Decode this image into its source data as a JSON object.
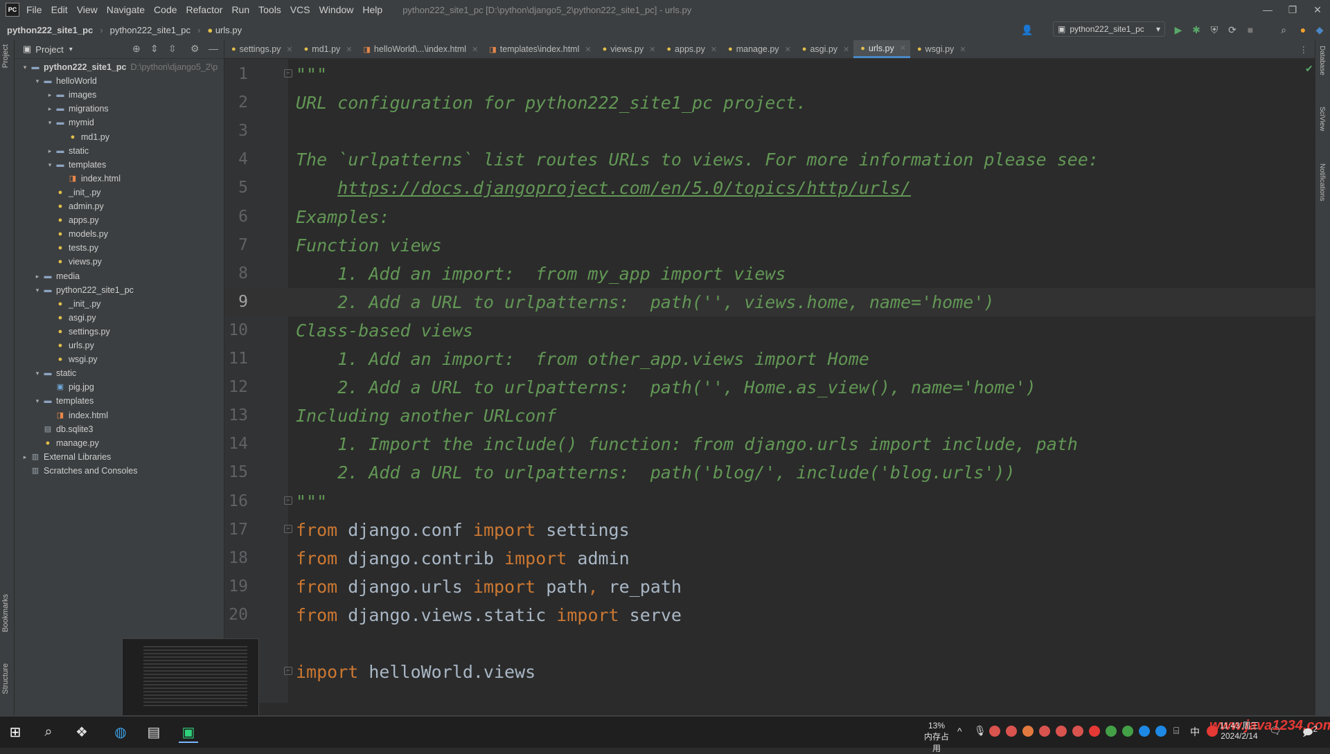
{
  "menubar": {
    "logo": "PC",
    "items": [
      "File",
      "Edit",
      "View",
      "Navigate",
      "Code",
      "Refactor",
      "Run",
      "Tools",
      "VCS",
      "Window",
      "Help"
    ],
    "window_title": "python222_site1_pc [D:\\python\\django5_2\\python222_site1_pc] - urls.py"
  },
  "navbar": {
    "breadcrumbs": [
      "python222_site1_pc",
      "python222_site1_pc",
      "urls.py"
    ],
    "run_config": "python222_site1_pc"
  },
  "project_panel": {
    "title": "Project",
    "tree": [
      {
        "depth": 0,
        "arrow": "▾",
        "icon": "folder",
        "label": "python222_site1_pc",
        "hint": "D:\\python\\django5_2\\p",
        "bold": true
      },
      {
        "depth": 1,
        "arrow": "▾",
        "icon": "folder",
        "label": "helloWorld"
      },
      {
        "depth": 2,
        "arrow": "▸",
        "icon": "folder",
        "label": "images"
      },
      {
        "depth": 2,
        "arrow": "▸",
        "icon": "folder",
        "label": "migrations"
      },
      {
        "depth": 2,
        "arrow": "▾",
        "icon": "folder",
        "label": "mymid"
      },
      {
        "depth": 3,
        "arrow": "",
        "icon": "py",
        "label": "md1.py"
      },
      {
        "depth": 2,
        "arrow": "▸",
        "icon": "folder",
        "label": "static"
      },
      {
        "depth": 2,
        "arrow": "▾",
        "icon": "folder",
        "label": "templates"
      },
      {
        "depth": 3,
        "arrow": "",
        "icon": "html",
        "label": "index.html"
      },
      {
        "depth": 2,
        "arrow": "",
        "icon": "py",
        "label": "_init_.py"
      },
      {
        "depth": 2,
        "arrow": "",
        "icon": "py",
        "label": "admin.py"
      },
      {
        "depth": 2,
        "arrow": "",
        "icon": "py",
        "label": "apps.py"
      },
      {
        "depth": 2,
        "arrow": "",
        "icon": "py",
        "label": "models.py"
      },
      {
        "depth": 2,
        "arrow": "",
        "icon": "py",
        "label": "tests.py"
      },
      {
        "depth": 2,
        "arrow": "",
        "icon": "py",
        "label": "views.py"
      },
      {
        "depth": 1,
        "arrow": "▸",
        "icon": "folder",
        "label": "media"
      },
      {
        "depth": 1,
        "arrow": "▾",
        "icon": "folder",
        "label": "python222_site1_pc"
      },
      {
        "depth": 2,
        "arrow": "",
        "icon": "py",
        "label": "_init_.py"
      },
      {
        "depth": 2,
        "arrow": "",
        "icon": "py",
        "label": "asgi.py"
      },
      {
        "depth": 2,
        "arrow": "",
        "icon": "py",
        "label": "settings.py"
      },
      {
        "depth": 2,
        "arrow": "",
        "icon": "py",
        "label": "urls.py"
      },
      {
        "depth": 2,
        "arrow": "",
        "icon": "py",
        "label": "wsgi.py"
      },
      {
        "depth": 1,
        "arrow": "▾",
        "icon": "folder",
        "label": "static"
      },
      {
        "depth": 2,
        "arrow": "",
        "icon": "img",
        "label": "pig.jpg"
      },
      {
        "depth": 1,
        "arrow": "▾",
        "icon": "folder",
        "label": "templates"
      },
      {
        "depth": 2,
        "arrow": "",
        "icon": "html",
        "label": "index.html"
      },
      {
        "depth": 1,
        "arrow": "",
        "icon": "db",
        "label": "db.sqlite3"
      },
      {
        "depth": 1,
        "arrow": "",
        "icon": "py",
        "label": "manage.py"
      },
      {
        "depth": 0,
        "arrow": "▸",
        "icon": "lib",
        "label": "External Libraries"
      },
      {
        "depth": 0,
        "arrow": "",
        "icon": "lib",
        "label": "Scratches and Consoles"
      }
    ]
  },
  "left_strip": {
    "project": "Project",
    "bookmarks": "Bookmarks",
    "structure": "Structure"
  },
  "right_strip": {
    "database": "Database",
    "sciview": "SciView",
    "notifications": "Notifications"
  },
  "tabs": [
    {
      "label": "settings.py",
      "icon": "py",
      "active": false
    },
    {
      "label": "md1.py",
      "icon": "py",
      "active": false
    },
    {
      "label": "helloWorld\\...\\index.html",
      "icon": "html",
      "active": false
    },
    {
      "label": "templates\\index.html",
      "icon": "html",
      "active": false
    },
    {
      "label": "views.py",
      "icon": "py",
      "active": false
    },
    {
      "label": "apps.py",
      "icon": "py",
      "active": false
    },
    {
      "label": "manage.py",
      "icon": "py",
      "active": false
    },
    {
      "label": "asgi.py",
      "icon": "py",
      "active": false
    },
    {
      "label": "urls.py",
      "icon": "py",
      "active": true
    },
    {
      "label": "wsgi.py",
      "icon": "py",
      "active": false
    }
  ],
  "editor": {
    "current_line": 9,
    "lines": [
      {
        "n": "1",
        "fold": true,
        "segs": [
          {
            "t": "\"\"\"",
            "c": "doc"
          }
        ]
      },
      {
        "n": "2",
        "segs": [
          {
            "t": "URL configuration for python222_site1_pc project.",
            "c": "doc"
          }
        ]
      },
      {
        "n": "3",
        "segs": []
      },
      {
        "n": "4",
        "segs": [
          {
            "t": "The `urlpatterns` list routes URLs to views. For more information please see:",
            "c": "doc"
          }
        ]
      },
      {
        "n": "5",
        "segs": [
          {
            "t": "    ",
            "c": "doc"
          },
          {
            "t": "https://docs.djangoproject.com/en/5.0/topics/http/urls/",
            "c": "link"
          }
        ]
      },
      {
        "n": "6",
        "segs": [
          {
            "t": "Examples:",
            "c": "doc"
          }
        ]
      },
      {
        "n": "7",
        "segs": [
          {
            "t": "Function views",
            "c": "doc"
          }
        ]
      },
      {
        "n": "8",
        "segs": [
          {
            "t": "    1. Add an import:  from my_app import views",
            "c": "doc"
          }
        ]
      },
      {
        "n": "9",
        "segs": [
          {
            "t": "    2. Add a URL to urlpatterns:  path('', views.home, name='home')",
            "c": "doc"
          }
        ]
      },
      {
        "n": "10",
        "segs": [
          {
            "t": "Class-based views",
            "c": "doc"
          }
        ]
      },
      {
        "n": "11",
        "segs": [
          {
            "t": "    1. Add an import:  from other_app.views import Home",
            "c": "doc"
          }
        ]
      },
      {
        "n": "12",
        "segs": [
          {
            "t": "    2. Add a URL to urlpatterns:  path('', Home.as_view(), name='home')",
            "c": "doc"
          }
        ]
      },
      {
        "n": "13",
        "segs": [
          {
            "t": "Including another URLconf",
            "c": "doc"
          }
        ]
      },
      {
        "n": "14",
        "segs": [
          {
            "t": "    1. Import the include() function: from django.urls import include, path",
            "c": "doc"
          }
        ]
      },
      {
        "n": "15",
        "segs": [
          {
            "t": "    2. Add a URL to urlpatterns:  path('blog/', include('blog.urls'))",
            "c": "doc"
          }
        ]
      },
      {
        "n": "16",
        "fold": true,
        "segs": [
          {
            "t": "\"\"\"",
            "c": "doc"
          }
        ]
      },
      {
        "n": "17",
        "fold": true,
        "segs": [
          {
            "t": "from",
            "c": "kw"
          },
          {
            "t": " django.conf ",
            "c": "plain"
          },
          {
            "t": "import",
            "c": "kw"
          },
          {
            "t": " settings",
            "c": "plain"
          }
        ]
      },
      {
        "n": "18",
        "segs": [
          {
            "t": "from",
            "c": "kw"
          },
          {
            "t": " django.contrib ",
            "c": "plain"
          },
          {
            "t": "import",
            "c": "kw"
          },
          {
            "t": " admin",
            "c": "plain"
          }
        ]
      },
      {
        "n": "19",
        "segs": [
          {
            "t": "from",
            "c": "kw"
          },
          {
            "t": " django.urls ",
            "c": "plain"
          },
          {
            "t": "import",
            "c": "kw"
          },
          {
            "t": " path",
            "c": "plain"
          },
          {
            "t": ",",
            "c": "kw"
          },
          {
            "t": " re_path",
            "c": "plain"
          }
        ]
      },
      {
        "n": "20",
        "segs": [
          {
            "t": "from",
            "c": "kw"
          },
          {
            "t": " django.views.static ",
            "c": "plain"
          },
          {
            "t": "import",
            "c": "kw"
          },
          {
            "t": " serve",
            "c": "plain"
          }
        ]
      },
      {
        "n": "",
        "segs": []
      },
      {
        "n": "",
        "fold": true,
        "segs": [
          {
            "t": "import",
            "c": "kw"
          },
          {
            "t": " helloWorld.views",
            "c": "plain"
          }
        ]
      }
    ]
  },
  "taskbar": {
    "memory_percent": "13%",
    "memory_label": "内存占用",
    "ime": "中",
    "time": "11:43",
    "weekday": "周三",
    "date": "2024/2/14",
    "notif_count": "2",
    "watermark": "www.java1234.com"
  },
  "colors": {
    "accent": "#4a88c7",
    "docstring": "#629755",
    "keyword": "#cc7832",
    "text": "#a9b7c6",
    "panel": "#3c3f41",
    "editor": "#2b2b2b"
  }
}
